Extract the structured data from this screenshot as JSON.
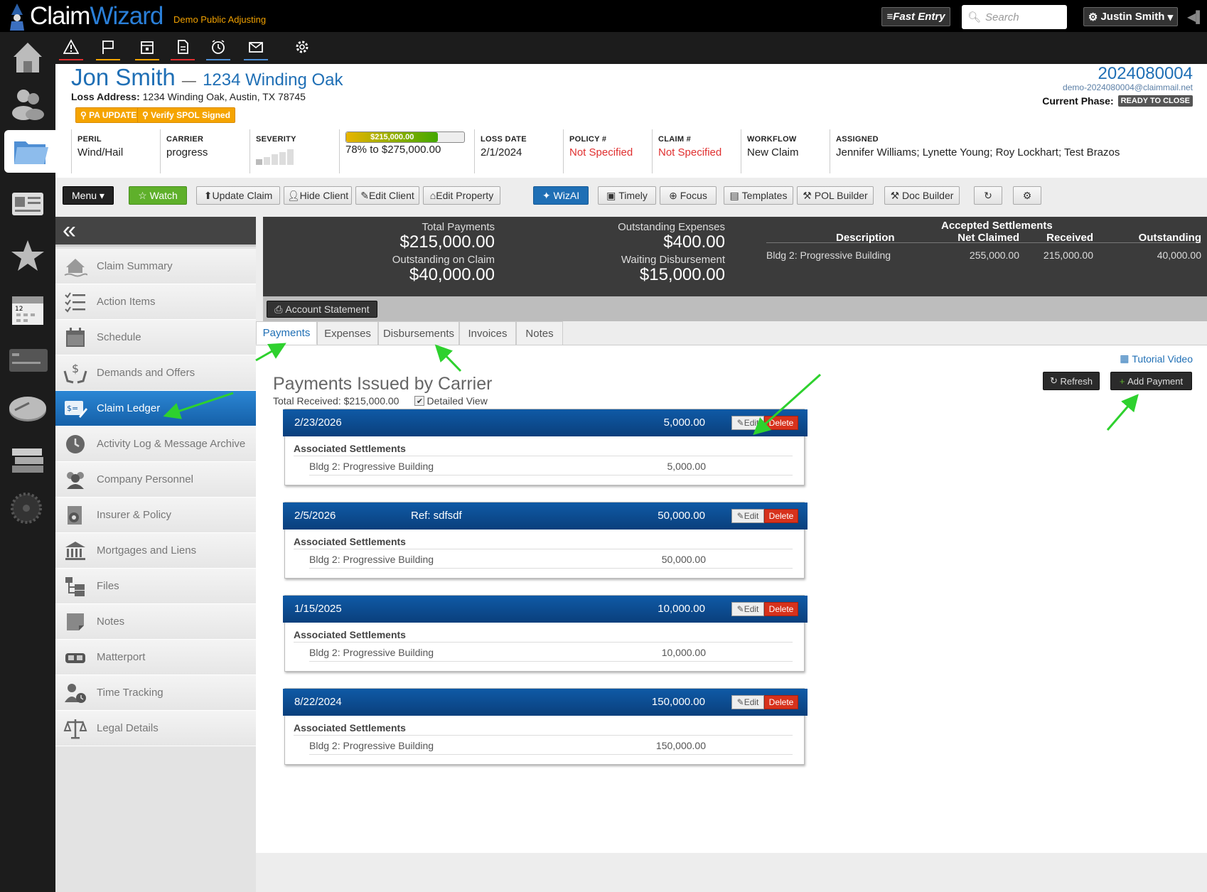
{
  "app": {
    "title_part1": "Claim",
    "title_part2": "Wizard",
    "company": "Demo Public Adjusting"
  },
  "topbar": {
    "fast_entry": "Fast Entry",
    "search_placeholder": "Search",
    "user": "Justin Smith"
  },
  "header": {
    "client_name": "Jon Smith",
    "property": "1234 Winding Oak",
    "loss_address_label": "Loss Address:",
    "loss_address": "1234 Winding Oak, Austin, TX 78745",
    "tags": [
      "PA UPDATE",
      "Verify SPOL Signed"
    ],
    "claim_number": "2024080004",
    "claim_email": "demo-2024080004@claimmail.net",
    "phase_label": "Current Phase:",
    "phase": "READY TO CLOSE"
  },
  "info": {
    "peril": {
      "label": "PERIL",
      "value": "Wind/Hail"
    },
    "carrier": {
      "label": "CARRIER",
      "value": "progress"
    },
    "severity": {
      "label": "SEVERITY",
      "level": 1,
      "max": 5
    },
    "progress": {
      "bar_text": "$215,000.00",
      "text": "78% to $275,000.00",
      "percent": 78
    },
    "loss_date": {
      "label": "LOSS DATE",
      "value": "2/1/2024"
    },
    "policy": {
      "label": "POLICY #",
      "value": "Not Specified"
    },
    "claim": {
      "label": "CLAIM #",
      "value": "Not Specified"
    },
    "workflow": {
      "label": "WORKFLOW",
      "value": "New Claim"
    },
    "assigned": {
      "label": "ASSIGNED",
      "value": "Jennifer Williams; Lynette Young; Roy Lockhart; Test Brazos"
    }
  },
  "toolbar": {
    "menu": "Menu",
    "watch": "Watch",
    "update_claim": "Update Claim",
    "hide_client": "Hide Client",
    "edit_client": "Edit Client",
    "edit_property": "Edit Property",
    "wizai": "WizAI",
    "timely": "Timely",
    "focus": "Focus",
    "templates": "Templates",
    "pol_builder": "POL Builder",
    "doc_builder": "Doc Builder"
  },
  "sidenav": [
    {
      "label": "Claim Summary",
      "icon": "house-flood-icon"
    },
    {
      "label": "Action Items",
      "icon": "checklist-icon"
    },
    {
      "label": "Schedule",
      "icon": "calendar-icon"
    },
    {
      "label": "Demands and Offers",
      "icon": "money-hands-icon"
    },
    {
      "label": "Claim Ledger",
      "icon": "ledger-icon"
    },
    {
      "label": "Activity Log & Message Archive",
      "icon": "clock-icon"
    },
    {
      "label": "Company Personnel",
      "icon": "people-icon"
    },
    {
      "label": "Insurer & Policy",
      "icon": "policy-icon"
    },
    {
      "label": "Mortgages and Liens",
      "icon": "bank-icon"
    },
    {
      "label": "Files",
      "icon": "folder-tree-icon"
    },
    {
      "label": "Notes",
      "icon": "note-icon"
    },
    {
      "label": "Matterport",
      "icon": "vr-headset-icon"
    },
    {
      "label": "Time Tracking",
      "icon": "person-clock-icon"
    },
    {
      "label": "Legal Details",
      "icon": "scales-icon"
    }
  ],
  "summary": {
    "total_payments_label": "Total Payments",
    "total_payments": "$215,000.00",
    "outstanding_claim_label": "Outstanding on Claim",
    "outstanding_claim": "$40,000.00",
    "outstanding_expenses_label": "Outstanding Expenses",
    "outstanding_expenses": "$400.00",
    "waiting_disbursement_label": "Waiting Disbursement",
    "waiting_disbursement": "$15,000.00",
    "settlements_title": "Accepted Settlements",
    "col_description": "Description",
    "col_net_claimed": "Net Claimed",
    "col_received": "Received",
    "col_outstanding": "Outstanding",
    "row": {
      "description": "Bldg 2: Progressive Building",
      "net_claimed": "255,000.00",
      "received": "215,000.00",
      "outstanding": "40,000.00"
    }
  },
  "account_statement": "Account Statement",
  "tabs": [
    "Payments",
    "Expenses",
    "Disbursements",
    "Invoices",
    "Notes"
  ],
  "panel": {
    "tutorial": "Tutorial Video",
    "title": "Payments Issued by Carrier",
    "total_received": "Total Received: $215,000.00",
    "detailed_view": "Detailed View",
    "refresh": "Refresh",
    "add_payment": "Add Payment",
    "edit_label": "Edit",
    "delete_label": "Delete",
    "assoc_label": "Associated Settlements",
    "payments": [
      {
        "date": "2/23/2026",
        "ref": "",
        "amount": "5,000.00",
        "settlement": "Bldg 2: Progressive Building",
        "settlement_amount": "5,000.00"
      },
      {
        "date": "2/5/2026",
        "ref": "Ref: sdfsdf",
        "amount": "50,000.00",
        "settlement": "Bldg 2: Progressive Building",
        "settlement_amount": "50,000.00"
      },
      {
        "date": "1/15/2025",
        "ref": "",
        "amount": "10,000.00",
        "settlement": "Bldg 2: Progressive Building",
        "settlement_amount": "10,000.00"
      },
      {
        "date": "8/22/2024",
        "ref": "",
        "amount": "150,000.00",
        "settlement": "Bldg 2: Progressive Building",
        "settlement_amount": "150,000.00"
      }
    ]
  },
  "colors": {
    "accent": "#1f6fb5",
    "watch": "#5fb02b",
    "tag": "#f5a400",
    "delete": "#d7321c",
    "arrow": "#2ed12e"
  }
}
